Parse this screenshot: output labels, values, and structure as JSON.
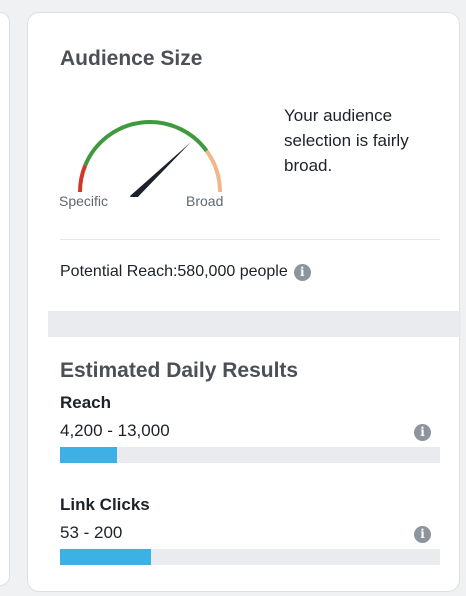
{
  "audience_size": {
    "title": "Audience Size",
    "gauge": {
      "specific_label": "Specific",
      "broad_label": "Broad",
      "level": 0.82,
      "colors": {
        "specific": "#d0382c",
        "middle": "#3f9a3f",
        "broad": "#f3b68a",
        "needle": "#1d2129"
      }
    },
    "description": "Your audience selection is fairly broad.",
    "potential_reach": "Potential Reach:580,000 people"
  },
  "estimated_daily_results": {
    "title": "Estimated Daily Results",
    "metrics": [
      {
        "label": "Reach",
        "range": "4,200 - 13,000",
        "fill": 0.15
      },
      {
        "label": "Link Clicks",
        "range": "53 - 200",
        "fill": 0.24
      }
    ]
  },
  "icons": {
    "info": "info-icon"
  },
  "colors": {
    "bar_fill": "#3db0e6",
    "bar_track": "#e9ebee"
  }
}
